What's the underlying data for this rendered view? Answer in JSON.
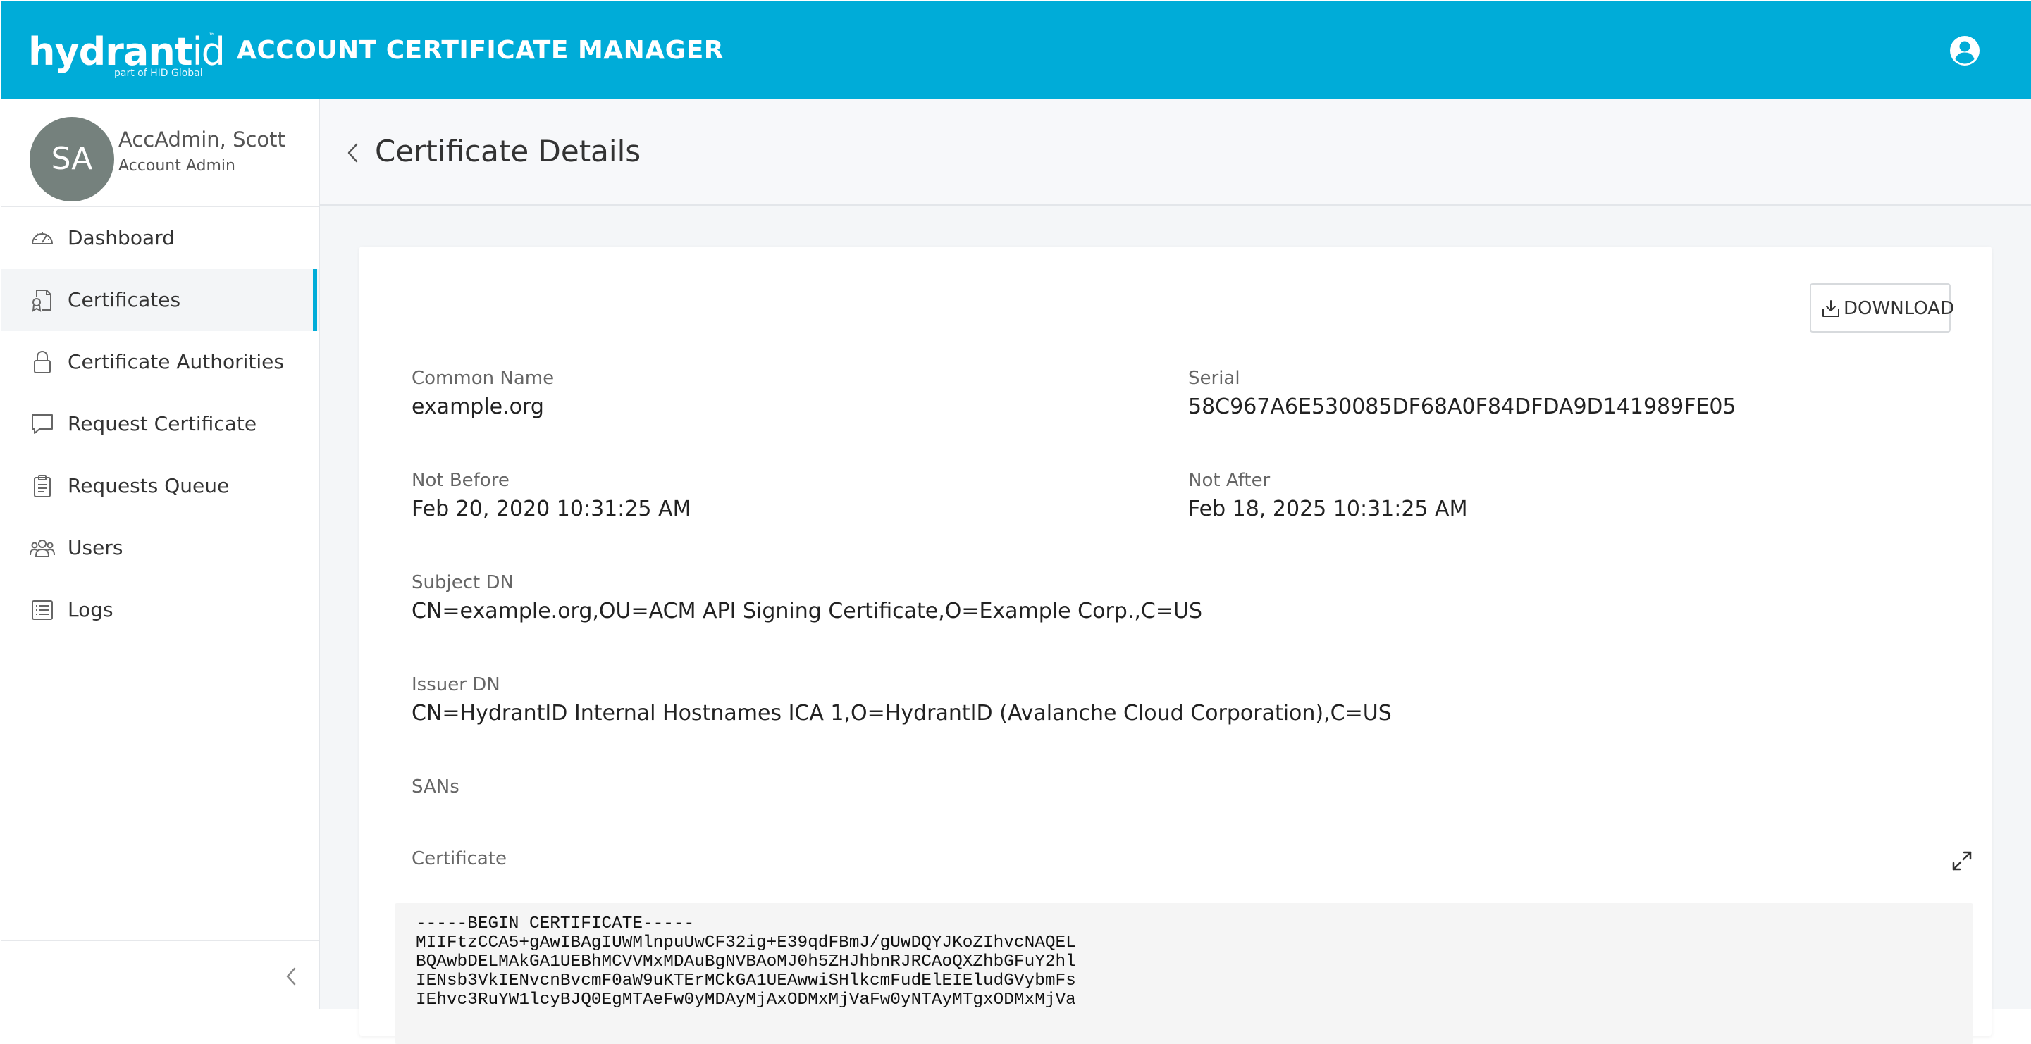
{
  "topbar": {
    "logo_main": "hydrant",
    "logo_id": "id",
    "logo_tm": "™",
    "logo_sub": "part of HID Global",
    "app_title": "ACCOUNT CERTIFICATE MANAGER",
    "accent_color": "#00acd8"
  },
  "sidebar": {
    "profile": {
      "initials": "SA",
      "name": "AccAdmin, Scott",
      "role": "Account Admin"
    },
    "items": [
      {
        "label": "Dashboard",
        "icon": "dashboard-icon"
      },
      {
        "label": "Certificates",
        "icon": "certificate-icon",
        "active": true
      },
      {
        "label": "Certificate Authorities",
        "icon": "lock-icon"
      },
      {
        "label": "Request Certificate",
        "icon": "chat-bubble-icon"
      },
      {
        "label": "Requests Queue",
        "icon": "clipboard-icon"
      },
      {
        "label": "Users",
        "icon": "users-icon"
      },
      {
        "label": "Logs",
        "icon": "list-icon"
      }
    ]
  },
  "main": {
    "page_title": "Certificate Details",
    "download_label": "DOWNLOAD",
    "fields": {
      "common_name": {
        "label": "Common Name",
        "value": "example.org"
      },
      "serial": {
        "label": "Serial",
        "value": "58C967A6E530085DF68A0F84DFDA9D141989FE05"
      },
      "not_before": {
        "label": "Not Before",
        "value": "Feb 20, 2020 10:31:25 AM"
      },
      "not_after": {
        "label": "Not After",
        "value": "Feb 18, 2025 10:31:25 AM"
      },
      "subject_dn": {
        "label": "Subject DN",
        "value": "CN=example.org,OU=ACM API Signing Certificate,O=Example Corp.,C=US"
      },
      "issuer_dn": {
        "label": "Issuer DN",
        "value": "CN=HydrantID Internal Hostnames ICA 1,O=HydrantID (Avalanche Cloud Corporation),C=US"
      },
      "sans": {
        "label": "SANs",
        "value": ""
      },
      "certificate": {
        "label": "Certificate"
      }
    },
    "certificate_pem": "-----BEGIN CERTIFICATE-----\nMIIFtzCCA5+gAwIBAgIUWMlnpuUwCF32ig+E39qdFBmJ/gUwDQYJKoZIhvcNAQEL\nBQAwbDELMAkGA1UEBhMCVVMxMDAuBgNVBAoMJ0h5ZHJhbnRJRCAoQXZhbGFuY2hl\nIENsb3VkIENvcnBvcmF0aW9uKTErMCkGA1UEAwwiSHlkcmFudElEIEludGVybmFs\nIEhvc3RuYW1lcyBJQ0EgMTAeFw0yMDAyMjAxODMxMjVaFw0yNTAyMTgxODMxMjVa"
  }
}
